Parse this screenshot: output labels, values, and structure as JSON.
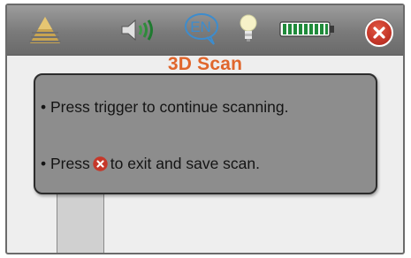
{
  "topbar": {
    "logo_icon": "layered-pyramid-logo-icon",
    "speaker_icon": "speaker-volume-icon",
    "language": "EN",
    "bulb_icon": "lightbulb-icon",
    "battery_icon": "battery-icon",
    "battery_level": 1.0,
    "close_icon": "close-x-icon"
  },
  "title": "3D Scan",
  "dialog": {
    "line1": "• Press trigger to continue scanning.",
    "line2_prefix": "• Press",
    "line2_suffix": "to exit and save scan.",
    "inline_icon": "close-x-icon"
  },
  "colors": {
    "title": "#e0662c",
    "close_button": "#c6382a",
    "battery": "#1f8a3a",
    "speaker_waves": "#2e8b3a",
    "language": "#3d8ccd",
    "dialog_bg": "#8d8d8d",
    "topbar": "#7a7a7a"
  }
}
